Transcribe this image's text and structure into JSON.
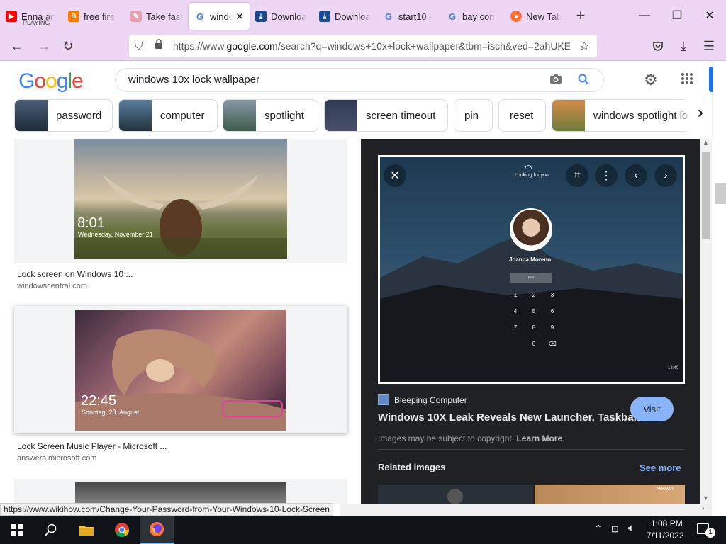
{
  "tabs": [
    {
      "label": "Enna an",
      "sub": "PLAYING",
      "icon": "youtube-icon",
      "color": "#ff0000"
    },
    {
      "label": "free fire",
      "icon": "blogger-icon",
      "color": "#f57c00"
    },
    {
      "label": "Take fast",
      "icon": "page-icon",
      "color": "#e57373"
    },
    {
      "label": "windo",
      "icon": "google-icon",
      "color": "#4285f4",
      "active": true
    },
    {
      "label": "Downloa",
      "icon": "download-site-icon",
      "color": "#1a4a8c"
    },
    {
      "label": "Downloa",
      "icon": "download-site-icon",
      "color": "#1a4a8c"
    },
    {
      "label": "start10 -",
      "icon": "google-icon",
      "color": "#4285f4"
    },
    {
      "label": "bay corr",
      "icon": "google-icon",
      "color": "#4285f4"
    },
    {
      "label": "New Tab",
      "icon": "firefox-icon",
      "color": "#ff7139"
    }
  ],
  "url": {
    "prefix": "https://www.",
    "domain": "google.com",
    "rest": "/search?q=windows+10x+lock+wallpaper&tbm=isch&ved=2ahUKE"
  },
  "google": {
    "logo": [
      "G",
      "o",
      "o",
      "g",
      "l",
      "e"
    ],
    "query": "windows 10x lock wallpaper",
    "chips": [
      "password",
      "computer",
      "spotlight",
      "screen timeout",
      "pin",
      "reset",
      "windows spotlight lo"
    ]
  },
  "results": [
    {
      "caption": "Lock screen on Windows 10 ...",
      "source": "windowscentral.com",
      "overlay_time": "8:01",
      "overlay_date": "Wednesday, November 21"
    },
    {
      "caption": "Lock Screen Music Player - Microsoft ...",
      "source": "answers.microsoft.com",
      "overlay_time": "22:45",
      "overlay_date": "Sonntag, 23. August"
    }
  ],
  "preview": {
    "looking": "Looking for you",
    "user": "Joanna Moreno",
    "pin_hint": "PIN",
    "keypad": [
      "1",
      "2",
      "3",
      "4",
      "5",
      "6",
      "7",
      "8",
      "9",
      "0",
      "⌫"
    ],
    "corner_time": "12:40",
    "site": "Bleeping Computer",
    "title": "Windows 10X Leak Reveals New Launcher, Taskba...",
    "visit": "Visit",
    "copyright": "Images may be subject to copyright.",
    "learn_more": "Learn More",
    "related": "Related images",
    "see_more": "See more",
    "related_watermark": "Neowin"
  },
  "status_url": "https://www.wikihow.com/Change-Your-Password-from-Your-Windows-10-Lock-Screen",
  "taskbar": {
    "time": "1:08 PM",
    "date": "7/11/2022",
    "notif_count": "1"
  },
  "colors": {
    "chrome_bg": "#eed7f5",
    "accent": "#8ab4f8",
    "link_blue": "#8ab4f8"
  }
}
